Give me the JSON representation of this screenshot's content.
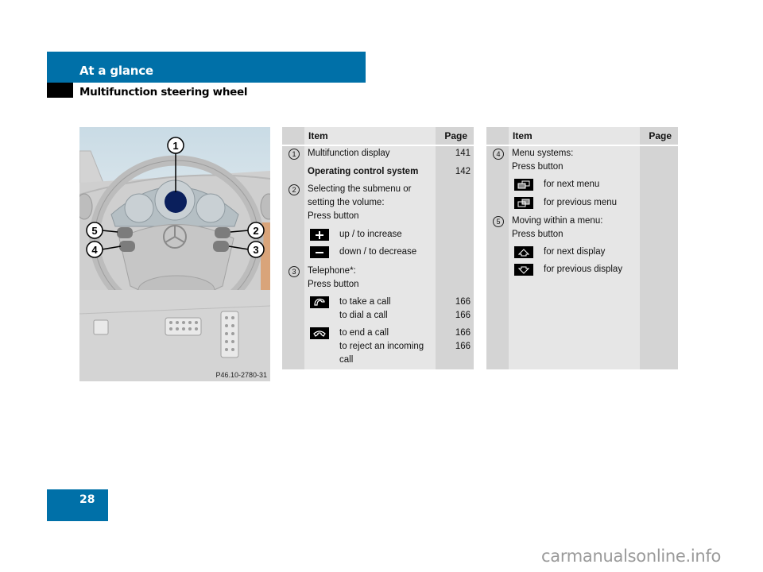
{
  "header": {
    "section": "At a glance",
    "subsection": "Multifunction steering wheel"
  },
  "figure": {
    "image_id": "P46.10-2780-31",
    "callouts": [
      "1",
      "2",
      "3",
      "4",
      "5"
    ],
    "colors": {
      "display_highlight": "#0a1f5c"
    }
  },
  "table_left": {
    "headers": {
      "item": "Item",
      "page": "Page"
    },
    "rows": {
      "r1": {
        "num": "1",
        "text": "Multifunction display",
        "page": "141"
      },
      "r1b": {
        "text": "Operating control system",
        "page": "142"
      },
      "r2": {
        "num": "2",
        "line1": "Selecting the submenu or",
        "line2": "setting the volume:",
        "line3": "Press button"
      },
      "r2a": {
        "icon": "plus-icon",
        "text": "up / to increase"
      },
      "r2b": {
        "icon": "minus-icon",
        "text": "down / to decrease"
      },
      "r3": {
        "num": "3",
        "line1": "Telephone*:",
        "line2": "Press button"
      },
      "r3a": {
        "icon": "phone-pickup-icon",
        "line1": "to take a call",
        "line2": "to dial a call",
        "page1": "166",
        "page2": "166"
      },
      "r3b": {
        "icon": "phone-hangup-icon",
        "line1": "to end a call",
        "line2": "to reject an incoming",
        "line3": "call",
        "page1": "166",
        "page2": "166"
      }
    }
  },
  "table_right": {
    "headers": {
      "item": "Item",
      "page": "Page"
    },
    "rows": {
      "r4": {
        "num": "4",
        "line1": "Menu systems:",
        "line2": "Press button"
      },
      "r4a": {
        "icon": "next-menu-icon",
        "text": "for next menu"
      },
      "r4b": {
        "icon": "previous-menu-icon",
        "text": "for previous menu"
      },
      "r5": {
        "num": "5",
        "line1": "Moving within a menu:",
        "line2": "Press button"
      },
      "r5a": {
        "icon": "up-arrow-icon",
        "text": "for next display"
      },
      "r5b": {
        "icon": "down-arrow-icon",
        "text": "for previous display"
      }
    }
  },
  "footer": {
    "page_number": "28",
    "watermark": "carmanualsonline.info"
  },
  "colors": {
    "brand_blue": "#0070a8",
    "table_bg": "#e6e6e6",
    "table_col_bg": "#d4d4d4"
  }
}
